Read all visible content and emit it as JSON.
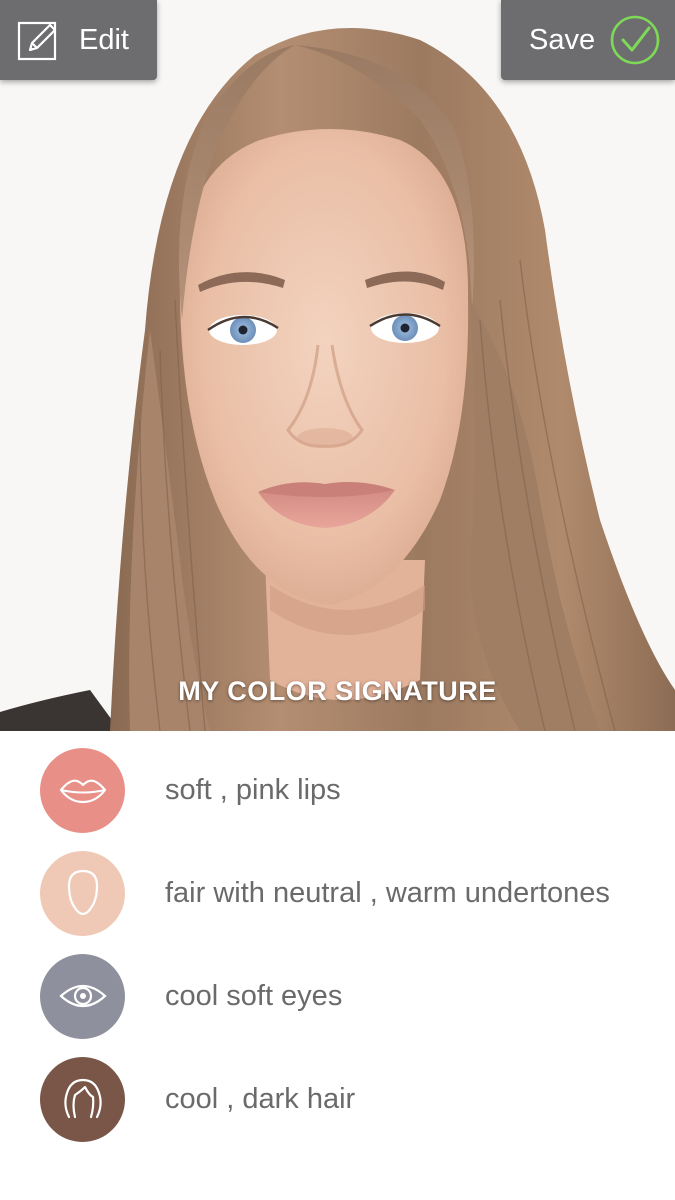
{
  "toolbar": {
    "edit_label": "Edit",
    "save_label": "Save"
  },
  "photo": {
    "caption": "MY COLOR SIGNATURE"
  },
  "signature": {
    "items": [
      {
        "label": "soft , pink lips",
        "icon": "lips-icon",
        "color": "#e89088"
      },
      {
        "label": "fair with neutral , warm undertones",
        "icon": "face-icon",
        "color": "#f0c9b6"
      },
      {
        "label": "cool soft eyes",
        "icon": "eye-icon",
        "color": "#8f909e"
      },
      {
        "label": "cool , dark hair",
        "icon": "hair-icon",
        "color": "#7a5648"
      }
    ]
  },
  "colors": {
    "button_bg": "#6d6d70",
    "check_green": "#7ed957",
    "text_gray": "#6a6a6a"
  }
}
